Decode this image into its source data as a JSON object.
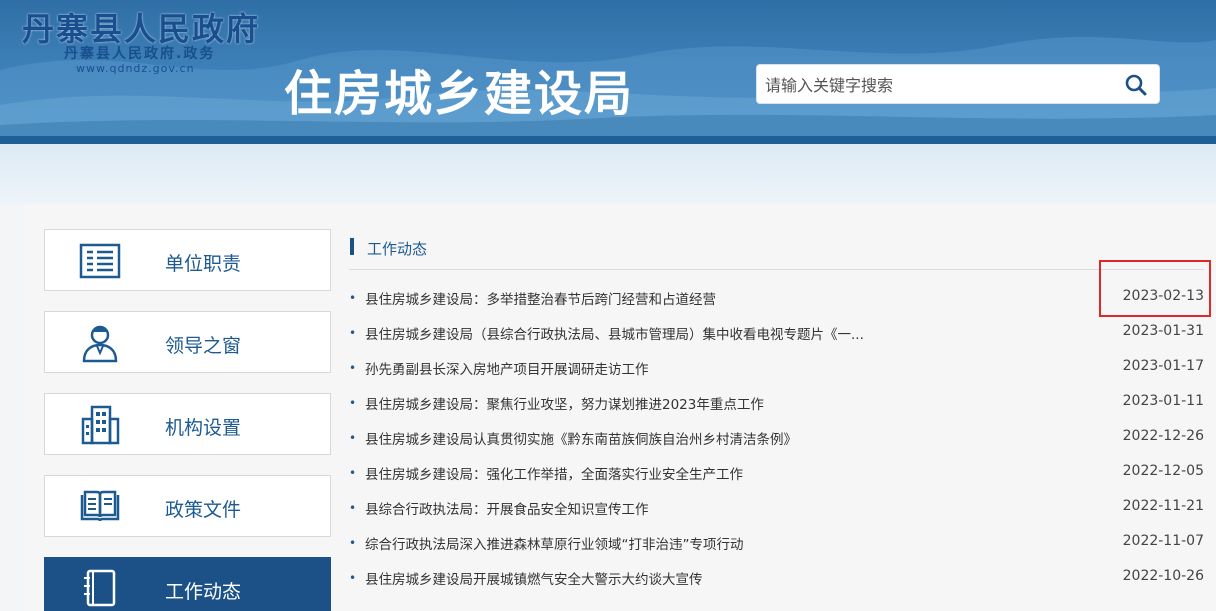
{
  "header": {
    "logo_main": "丹寨县人民政府",
    "logo_sub": "丹寨县人民政府.政务",
    "logo_url": "www.qdndz.gov.cn",
    "site_title": "住房城乡建设局",
    "search_placeholder": "请输入关键字搜索",
    "search_icon": "search-icon"
  },
  "sidebar": {
    "items": [
      {
        "label": "单位职责",
        "icon": "document-list-icon",
        "active": false
      },
      {
        "label": "领导之窗",
        "icon": "person-icon",
        "active": false
      },
      {
        "label": "机构设置",
        "icon": "building-icon",
        "active": false
      },
      {
        "label": "政策文件",
        "icon": "open-book-icon",
        "active": false
      },
      {
        "label": "工作动态",
        "icon": "notebook-icon",
        "active": true
      }
    ]
  },
  "section": {
    "title": "工作动态"
  },
  "news": [
    {
      "title": "县住房城乡建设局：多举措整治春节后跨门经营和占道经营",
      "date": "2023-02-13"
    },
    {
      "title": "县住房城乡建设局（县综合行政执法局、县城市管理局）集中收看电视专题片《一...",
      "date": "2023-01-31"
    },
    {
      "title": "孙先勇副县长深入房地产项目开展调研走访工作",
      "date": "2023-01-17"
    },
    {
      "title": "县住房城乡建设局：聚焦行业攻坚，努力谋划推进2023年重点工作",
      "date": "2023-01-11"
    },
    {
      "title": "县住房城乡建设局认真贯彻实施《黔东南苗族侗族自治州乡村清洁条例》",
      "date": "2022-12-26"
    },
    {
      "title": "县住房城乡建设局：强化工作举措，全面落实行业安全生产工作",
      "date": "2022-12-05"
    },
    {
      "title": "县综合行政执法局：开展食品安全知识宣传工作",
      "date": "2022-11-21"
    },
    {
      "title": "综合行政执法局深入推进森林草原行业领域“打非治违”专项行动",
      "date": "2022-11-07"
    },
    {
      "title": "县住房城乡建设局开展城镇燃气安全大警示大约谈大宣传",
      "date": "2022-10-26"
    }
  ],
  "colors": {
    "accent": "#1b5186",
    "highlight": "#e02828"
  }
}
